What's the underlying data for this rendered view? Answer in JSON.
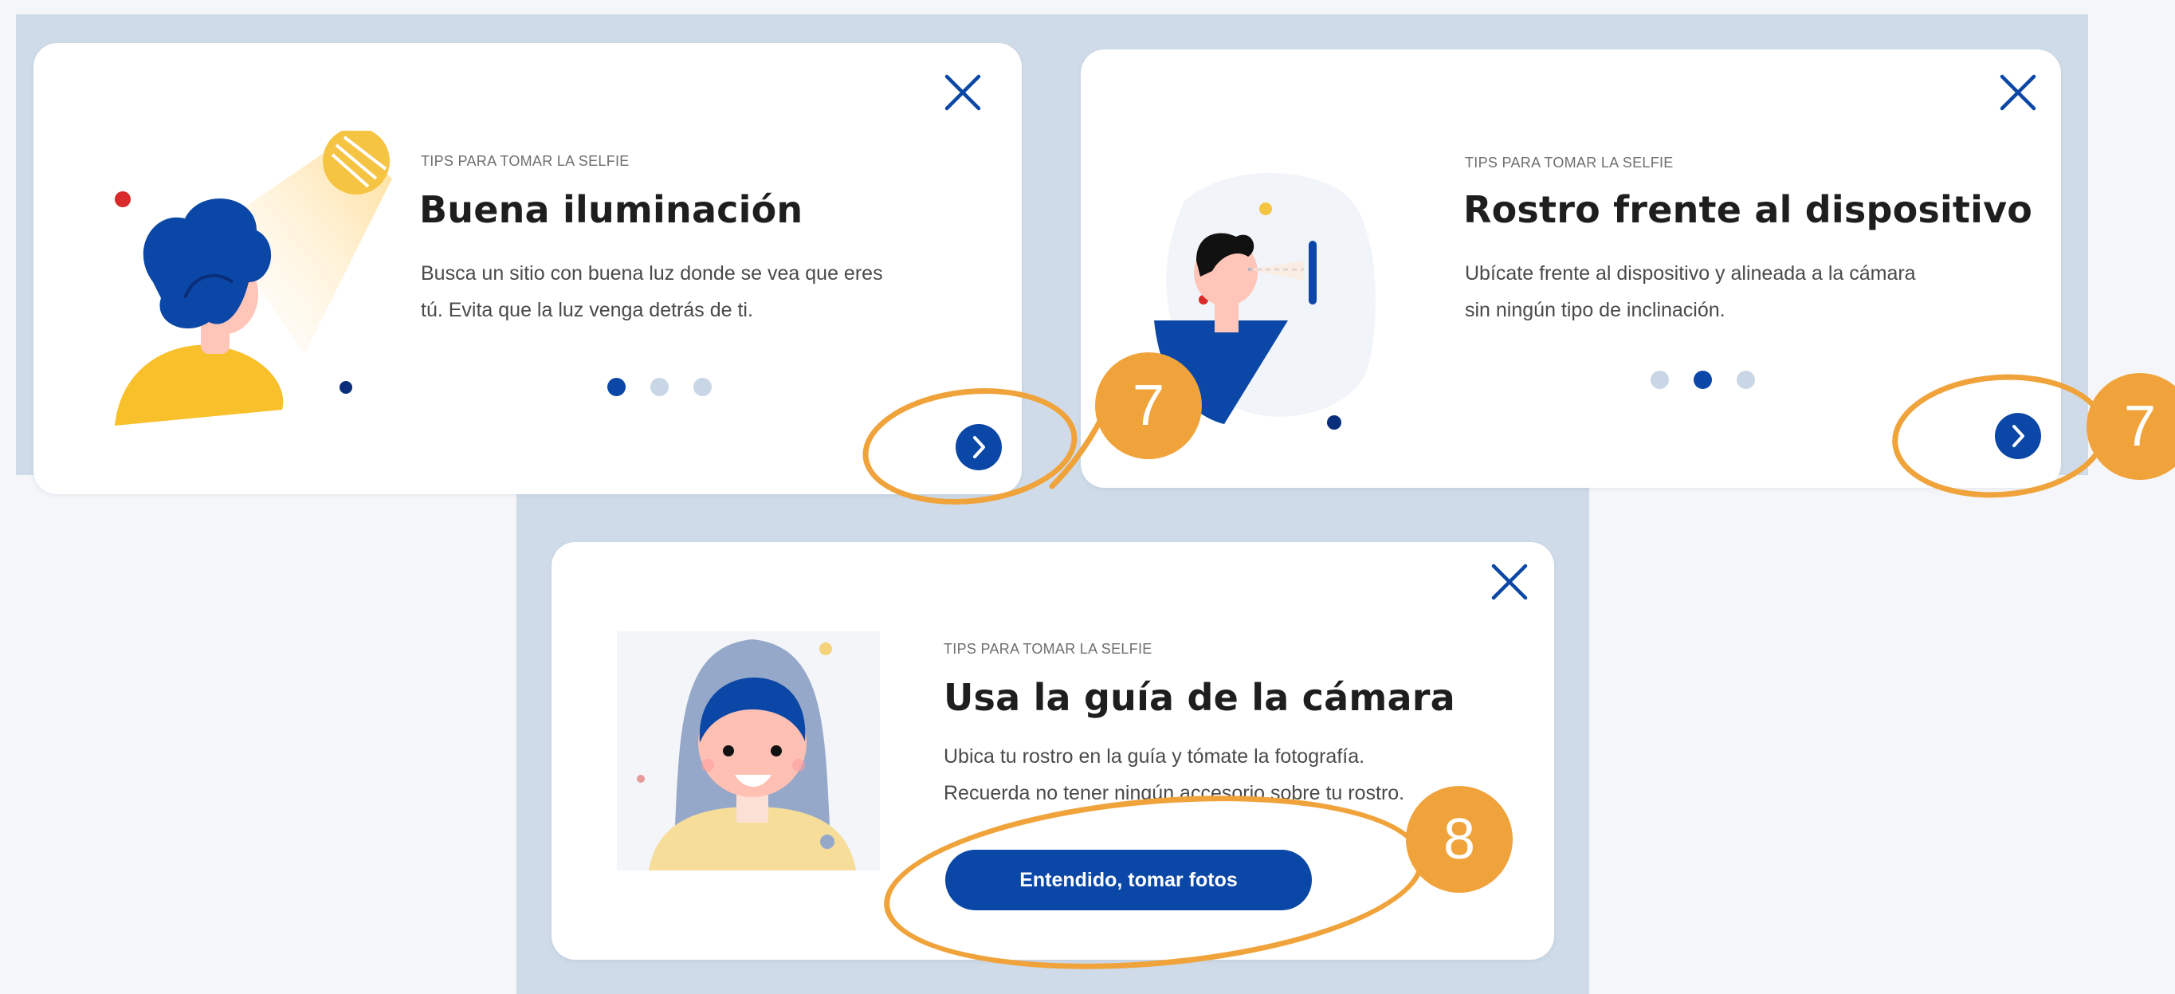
{
  "cards": [
    {
      "eyebrow": "TIPS PARA TOMAR LA SELFIE",
      "title": "Buena iluminación",
      "description_lines": [
        "Busca un sitio con buena luz donde se vea que eres",
        "tú. Evita que la luz venga detrás de ti."
      ],
      "pagination": {
        "total": 3,
        "active": 1
      },
      "next_icon": "chevron-right-icon",
      "close_icon": "close-icon"
    },
    {
      "eyebrow": "TIPS PARA TOMAR LA SELFIE",
      "title": "Rostro frente al dispositivo",
      "description_lines": [
        "Ubícate frente al dispositivo y alineada a la cámara",
        "sin ningún tipo de inclinación."
      ],
      "pagination": {
        "total": 3,
        "active": 2
      },
      "next_icon": "chevron-right-icon",
      "close_icon": "close-icon"
    },
    {
      "eyebrow": "TIPS PARA TOMAR LA SELFIE",
      "title": "Usa la guía de la cámara",
      "description_lines": [
        "Ubica tu rostro en la guía y tómate la fotografía.",
        "Recuerda no tener ningún accesorio sobre tu rostro."
      ],
      "cta_label": "Entendido, tomar fotos",
      "close_icon": "close-icon"
    }
  ],
  "annotations": {
    "badge_7_left": "7",
    "badge_7_right": "7",
    "badge_8": "8"
  },
  "colors": {
    "primary": "#0b47a6",
    "annotation": "#f0a33a",
    "panel": "#cfdbe8",
    "dot_inactive": "#c9d6e6"
  }
}
